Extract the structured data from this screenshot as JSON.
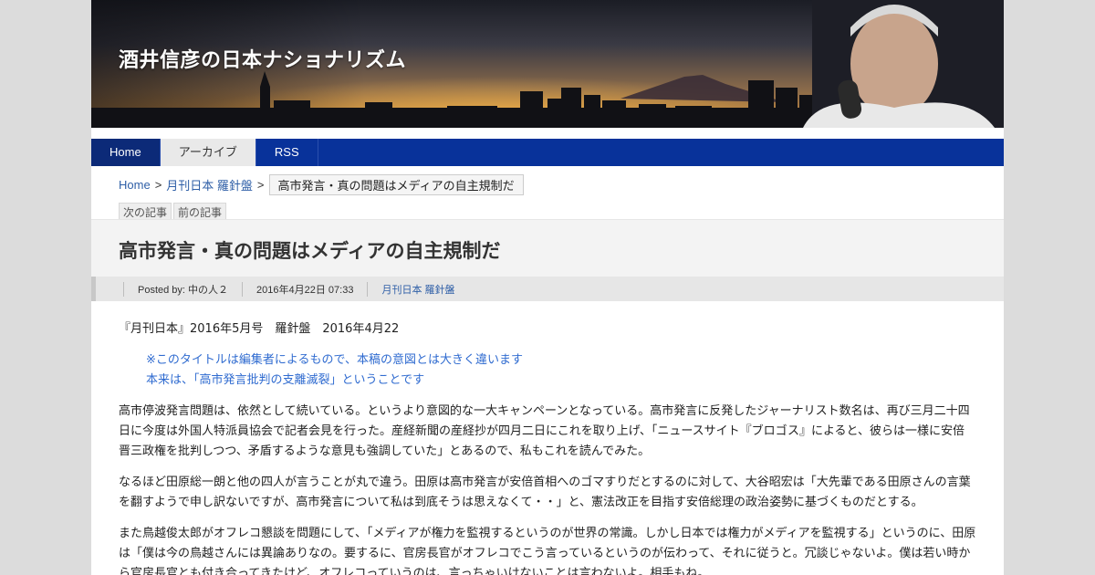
{
  "site": {
    "title": "酒井信彦の日本ナショナリズム"
  },
  "nav": {
    "items": [
      {
        "label": "Home"
      },
      {
        "label": "アーカイブ"
      },
      {
        "label": "RSS"
      }
    ]
  },
  "breadcrumb": {
    "home": "Home",
    "sep1": ">",
    "category": "月刊日本 羅針盤",
    "sep2": ">",
    "current": "高市発言・真の問題はメディアの自主規制だ"
  },
  "pager": {
    "next": "次の記事",
    "prev": "前の記事"
  },
  "post": {
    "title": "高市発言・真の問題はメディアの自主規制だ",
    "meta": {
      "posted_by": "Posted by: 中の人２",
      "date": "2016年4月22日 07:33",
      "category": "月刊日本 羅針盤"
    },
    "source_line": "『月刊日本』2016年5月号　羅針盤　2016年4月22",
    "note_line1": "※このタイトルは編集者によるもので、本稿の意図とは大きく違います",
    "note_line2": "本来は、「高市発言批判の支離滅裂」ということです",
    "para1": "高市停波発言問題は、依然として続いている。というより意図的な一大キャンペーンとなっている。高市発言に反発したジャーナリスト数名は、再び三月二十四日に今度は外国人特派員協会で記者会見を行った。産経新聞の産経抄が四月二日にこれを取り上げ、「ニュースサイト『ブロゴス』によると、彼らは一様に安倍晋三政権を批判しつつ、矛盾するような意見も強調していた」とあるので、私もこれを読んでみた。",
    "para2": "なるほど田原総一朗と他の四人が言うことが丸で違う。田原は高市発言が安倍首相へのゴマすりだとするのに対して、大谷昭宏は「大先輩である田原さんの言葉を翻すようで申し訳ないですが、高市発言について私は到底そうは思えなくて・・」と、憲法改正を目指す安倍総理の政治姿勢に基づくものだとする。",
    "para3": "また鳥越俊太郎がオフレコ懇談を問題にして、「メディアが権力を監視するというのが世界の常識。しかし日本では権力がメディアを監視する」というのに、田原は「僕は今の鳥越さんには異論ありなの。要するに、官房長官がオフレコでこう言っているというのが伝わって、それに従うと。冗談じゃないよ。僕は若い時から官房長官とも付き合ってきたけど、オフレコっていうのは、言っちゃいけないことは言わないよ。相手もね。"
  }
}
